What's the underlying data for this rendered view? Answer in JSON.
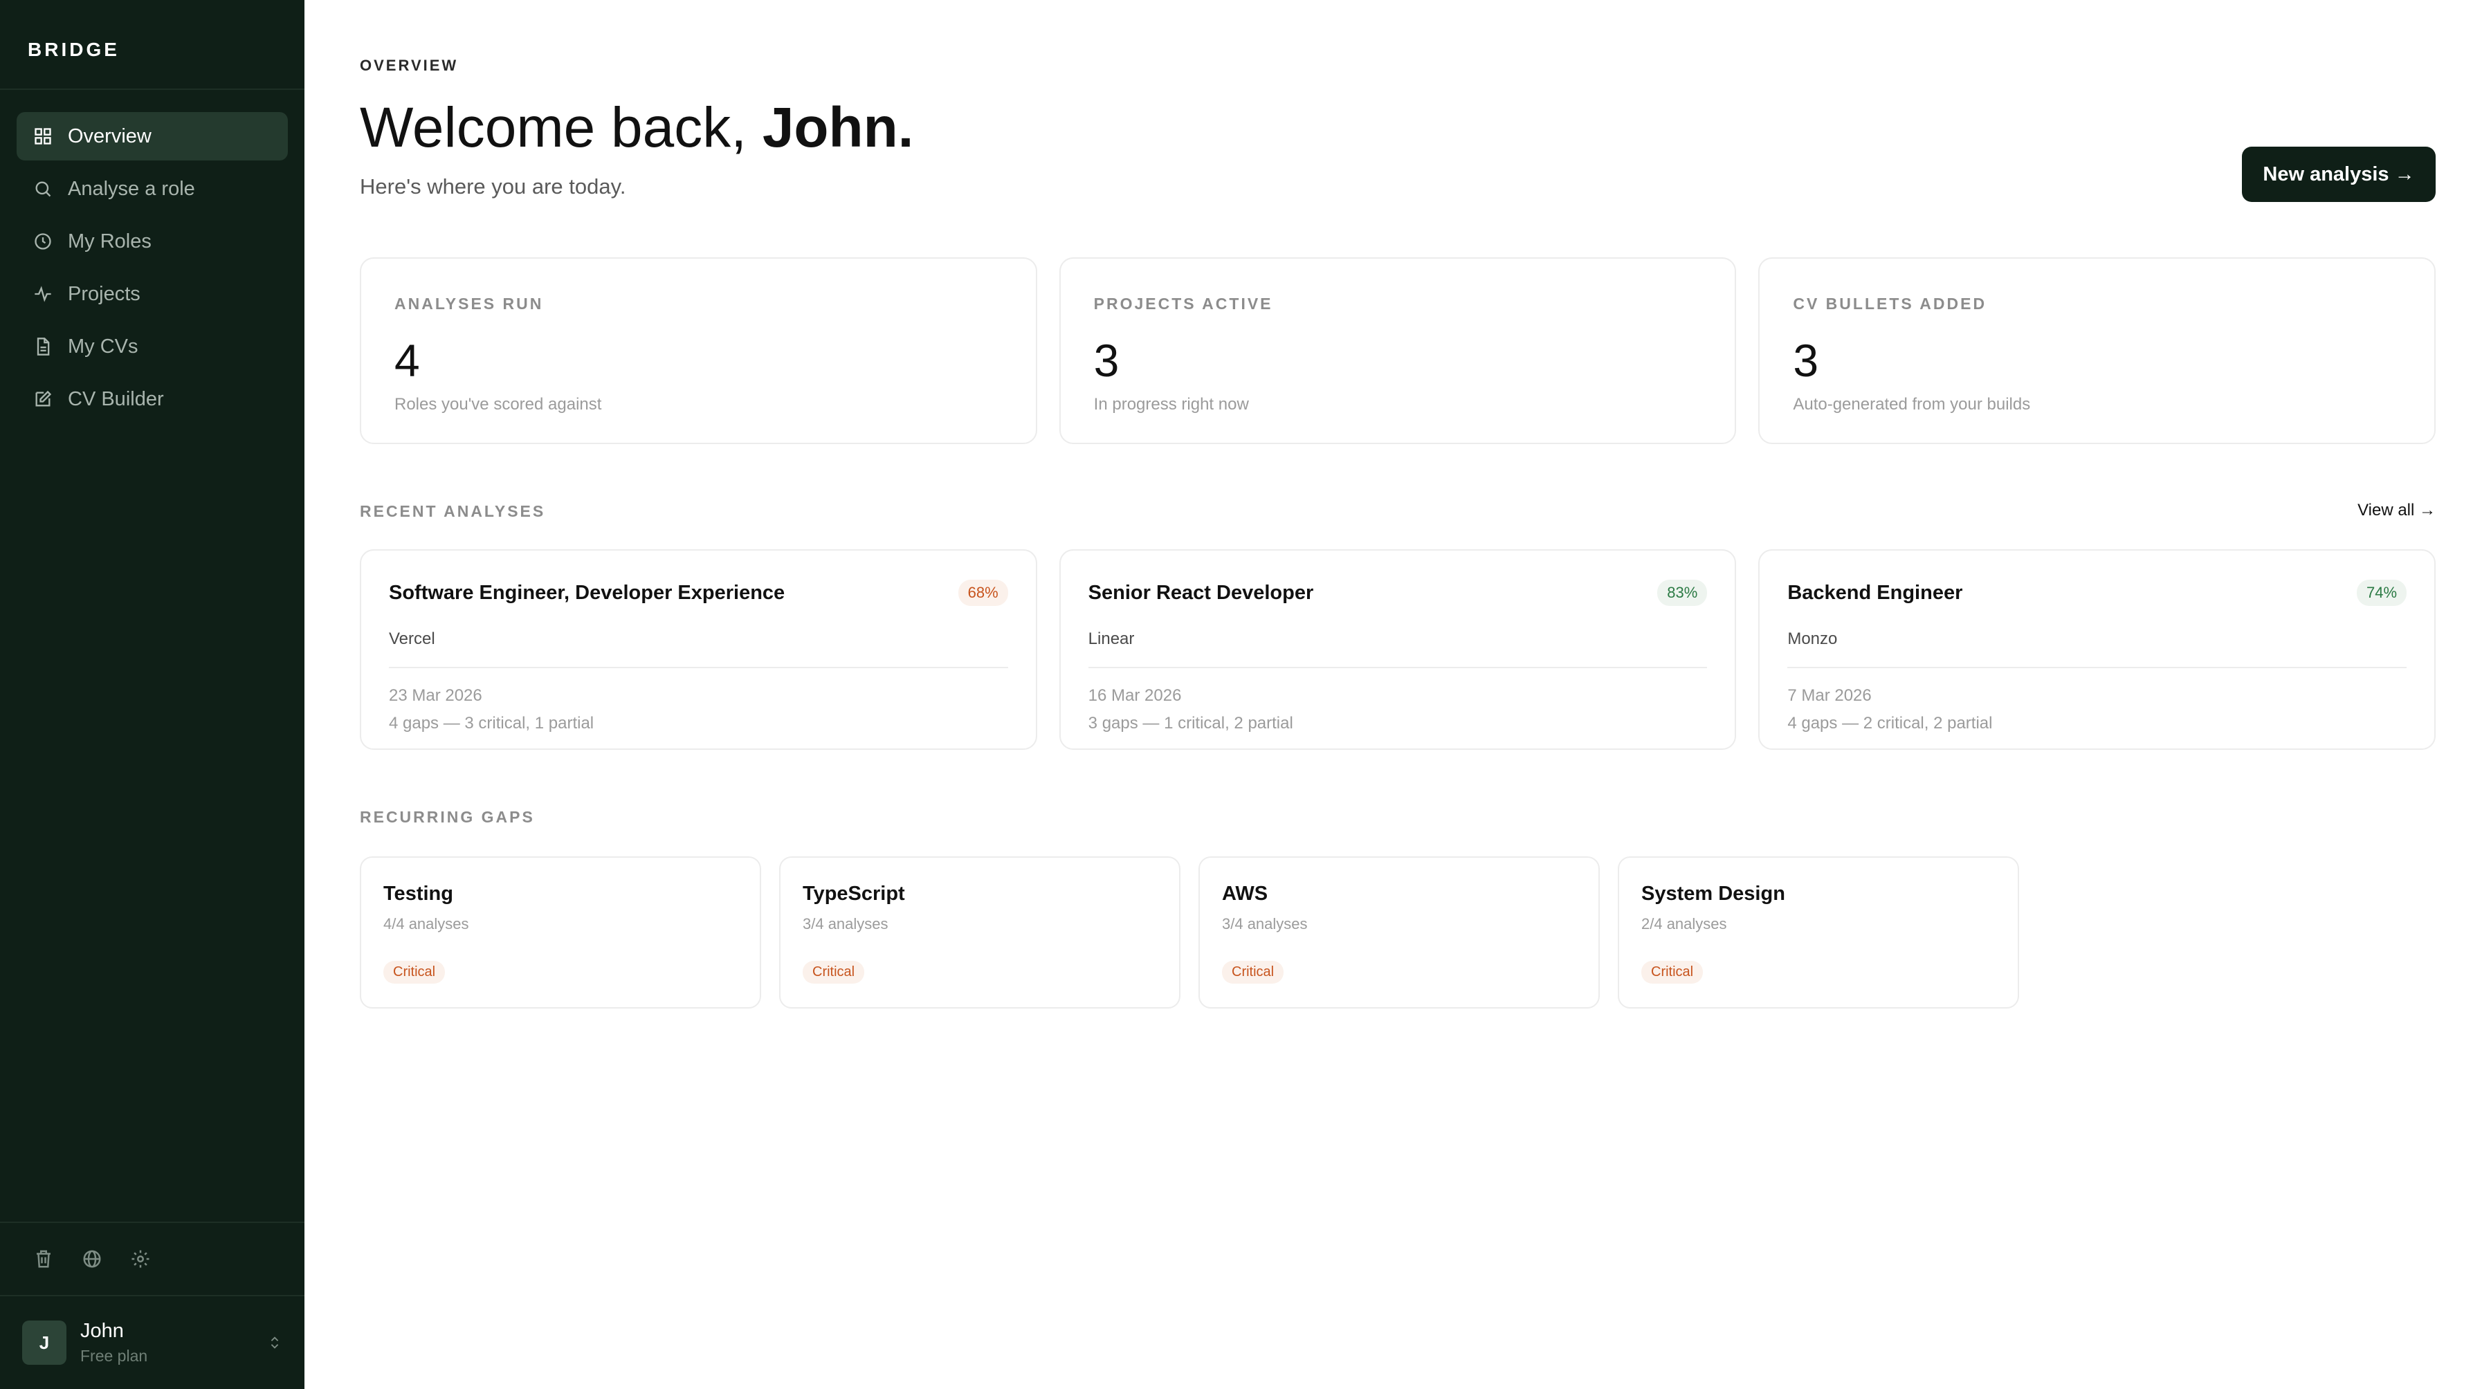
{
  "sidebar": {
    "brand": "BRIDGE",
    "items": [
      {
        "label": "Overview",
        "icon": "grid-icon"
      },
      {
        "label": "Analyse a role",
        "icon": "search-icon"
      },
      {
        "label": "My Roles",
        "icon": "clock-icon"
      },
      {
        "label": "Projects",
        "icon": "activity-icon"
      },
      {
        "label": "My CVs",
        "icon": "document-icon"
      },
      {
        "label": "CV Builder",
        "icon": "edit-icon"
      }
    ],
    "active_index": 0,
    "user": {
      "initial": "J",
      "name": "John",
      "plan": "Free plan"
    }
  },
  "header": {
    "eyebrow": "OVERVIEW",
    "title_prefix": "Welcome back, ",
    "title_name": "John.",
    "subtitle": "Here's where you are today.",
    "new_button": "New analysis →"
  },
  "stats": [
    {
      "label": "ANALYSES RUN",
      "value": "4",
      "desc": "Roles you've scored against"
    },
    {
      "label": "PROJECTS ACTIVE",
      "value": "3",
      "desc": "In progress right now"
    },
    {
      "label": "CV BULLETS ADDED",
      "value": "3",
      "desc": "Auto-generated from your builds"
    }
  ],
  "recent": {
    "label": "RECENT ANALYSES",
    "view_all": "View all →",
    "items": [
      {
        "role": "Software Engineer, Developer Experience",
        "score": "68%",
        "company": "Vercel",
        "date": "23 Mar 2026",
        "gaps": "4 gaps — 3 critical, 1 partial"
      },
      {
        "role": "Senior React Developer",
        "score": "83%",
        "company": "Linear",
        "date": "16 Mar 2026",
        "gaps": "3 gaps — 1 critical, 2 partial"
      },
      {
        "role": "Backend Engineer",
        "score": "74%",
        "company": "Monzo",
        "date": "7 Mar 2026",
        "gaps": "4 gaps — 2 critical, 2 partial"
      }
    ]
  },
  "gaps": {
    "label": "RECURRING GAPS",
    "items": [
      {
        "name": "Testing",
        "count": "4/4 analyses",
        "severity": "Critical"
      },
      {
        "name": "TypeScript",
        "count": "3/4 analyses",
        "severity": "Critical"
      },
      {
        "name": "AWS",
        "count": "3/4 analyses",
        "severity": "Critical"
      },
      {
        "name": "System Design",
        "count": "2/4 analyses",
        "severity": "Critical"
      }
    ]
  },
  "colors": {
    "sidebar_bg": "#0f1f17",
    "sidebar_active": "#243a2e",
    "critical": "#c7541d",
    "good": "#2b7a44"
  }
}
